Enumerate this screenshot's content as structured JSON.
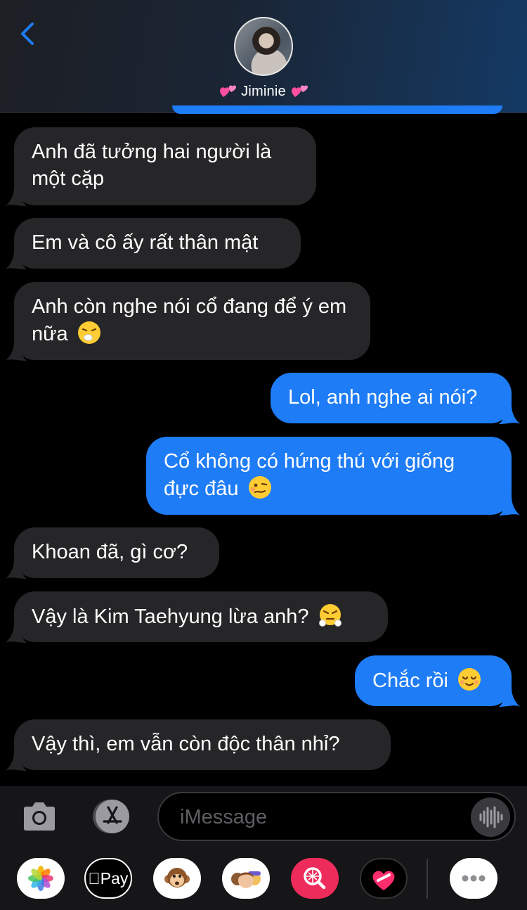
{
  "header": {
    "contact_name": "Jiminie",
    "back_icon": "chevron-left-icon",
    "avatar_icon": "contact-avatar",
    "name_decoration_icon": "two-hearts-emoji"
  },
  "colors": {
    "sent_bubble": "#1e7cf6",
    "received_bubble": "#262628",
    "accent": "#1e7cf6",
    "background": "#000000"
  },
  "messages": [
    {
      "direction": "received",
      "text": "Anh đã tưởng hai người là một cặp"
    },
    {
      "direction": "received",
      "text": "Em và cô ấy rất thân mật"
    },
    {
      "direction": "received",
      "text": "Anh còn nghe nói cổ đang để ý em nữa",
      "emoji": "sneezing-face-emoji"
    },
    {
      "direction": "sent",
      "text": "Lol, anh nghe ai nói?"
    },
    {
      "direction": "sent",
      "text": "Cổ không có hứng thú với giống đực đâu",
      "emoji": "woozy-face-emoji"
    },
    {
      "direction": "received",
      "text": "Khoan đã, gì cơ?"
    },
    {
      "direction": "received",
      "text": "Vậy là Kim Taehyung lừa anh?",
      "emoji": "face-with-steam-emoji"
    },
    {
      "direction": "sent",
      "text": "Chắc rồi",
      "emoji": "relieved-face-emoji"
    },
    {
      "direction": "received",
      "text": "Vậy thì, em vẫn còn độc thân nhỉ?"
    }
  ],
  "composer": {
    "placeholder": "iMessage",
    "camera_icon": "camera-icon",
    "appstore_icon": "app-store-icon",
    "audio_icon": "waveform-icon"
  },
  "app_drawer": [
    {
      "name": "photos-app-icon"
    },
    {
      "name": "apple-pay-icon",
      "label": "Pay"
    },
    {
      "name": "animoji-icon"
    },
    {
      "name": "memoji-icon"
    },
    {
      "name": "web-search-icon"
    },
    {
      "name": "digital-touch-icon"
    },
    {
      "name": "more-apps-icon"
    }
  ]
}
